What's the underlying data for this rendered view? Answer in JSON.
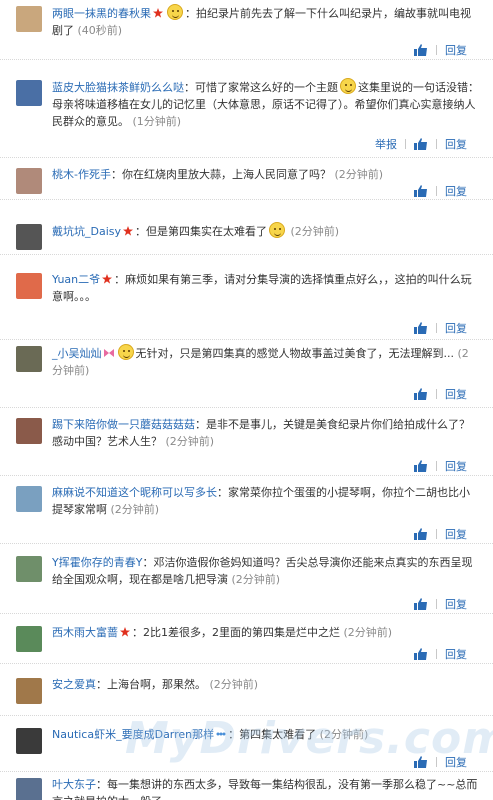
{
  "ui": {
    "reply_label": "回复",
    "report_label": "举报"
  },
  "watermark": "MyDrivers.com",
  "comments": [
    {
      "user": "两眼一抹黑的春秋果",
      "text": "：拍纪录片前先去了解一下什么叫纪录片，编故事就叫电视剧了",
      "time": "(40秒前)",
      "badge": "star-icon",
      "emoji_before": true,
      "report": false,
      "avatar_color": "#c9a77d"
    },
    {
      "user": "蓝皮大脸猫抹茶鲜奶么么哒",
      "text": "：可惜了家常这么好的一个主题",
      "text2": "这集里说的一句话没错：母亲将味道移植在女儿的记忆里（大体意思，原话不记得了）。希望你们真心实意接纳人民群众的意见。",
      "time": "(1分钟前)",
      "emoji_inline": true,
      "report": true,
      "avatar_color": "#4a6fa5"
    },
    {
      "user": "桃木-作死手",
      "text": "：你在红烧肉里放大蒜，上海人民同意了吗？",
      "time": "(2分钟前)",
      "avatar_color": "#b08a7a"
    },
    {
      "user": "戴坑坑_Daisy",
      "text": "：但是第四集实在太难看了",
      "time": "(2分钟前)",
      "badge": "star-icon",
      "emoji_inline": true,
      "avatar_color": "#555555"
    },
    {
      "user": "Yuan二爷",
      "text": "：麻烦如果有第三季，请对分集导演的选择慎重点好么，，这拍的叫什么玩意啊。。。",
      "time": "",
      "badge": "star-icon",
      "avatar_color": "#e06a4a"
    },
    {
      "user": "_小吴灿灿",
      "text": "无针对，只是第四集真的感觉人物故事盖过美食了，无法理解到...",
      "time": "(2分钟前)",
      "badge": "bow-icon",
      "emoji_before": true,
      "avatar_color": "#6a6a55"
    },
    {
      "user": "踢下来陪你做一只蘑菇菇菇菇",
      "text": "：是非不是事儿，关键是美食纪录片你们给拍成什么了？感动中国？艺术人生？",
      "time": "(2分钟前)",
      "avatar_color": "#8a5a4a"
    },
    {
      "user": "麻麻说不知道这个昵称可以写多长",
      "text": "：家常菜你拉个蛋蛋的小提琴啊，你拉个二胡也比小提琴家常啊",
      "time": "(2分钟前)",
      "avatar_color": "#7aa0c0"
    },
    {
      "user": "Y挥霍你存的青春Y",
      "text": "：邓洁你造假你爸妈知道吗？舌尖总导演你还能来点真实的东西呈现给全国观众啊，现在都是啥几把导演",
      "time": "(2分钟前)",
      "avatar_color": "#6f8f6a"
    },
    {
      "user": "西木雨大富蔷",
      "text": "：2比1差很多，2里面的第四集是烂中之烂",
      "time": "(2分钟前)",
      "badge": "star-icon",
      "avatar_color": "#5a8a5a"
    },
    {
      "user": "安之爱真",
      "text": "：上海台啊，那果然。",
      "time": "(2分钟前)",
      "avatar_color": "#a0784a"
    },
    {
      "user": "Nautica虾米_要度成Darren那样",
      "text": "：第四集太难看了",
      "time": "(2分钟前)",
      "badge": "dots-icon",
      "avatar_color": "#3a3a3a"
    },
    {
      "user": "叶大东子",
      "text": "：每一集想讲的东西太多，导致每一集结构很乱，没有第一季那么稳了~~总而言之就是拍的太一般了",
      "time": "",
      "avatar_color": "#5a7090"
    }
  ]
}
